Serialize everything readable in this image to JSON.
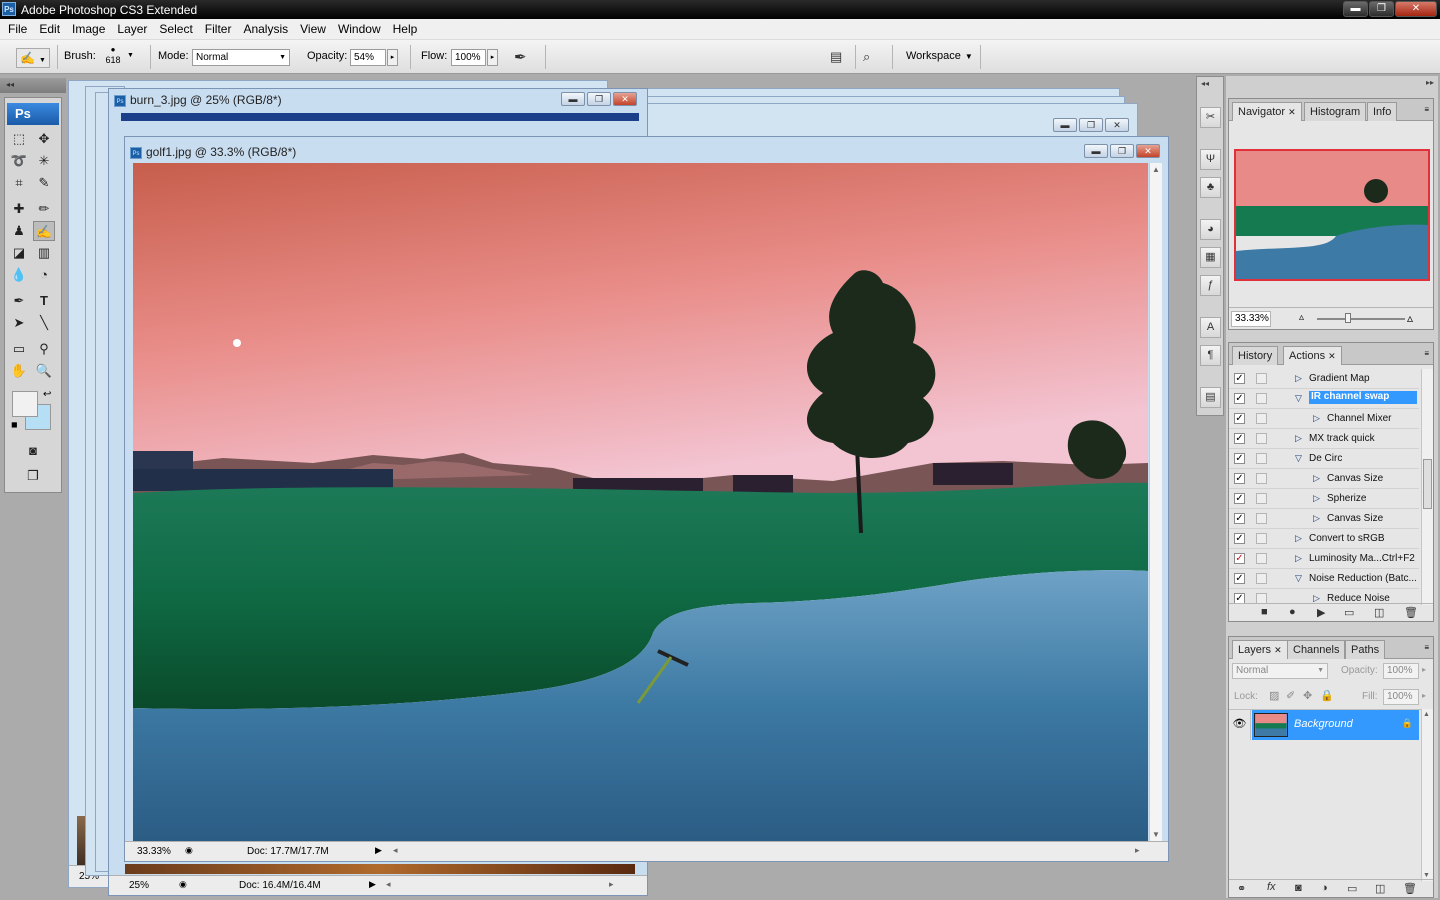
{
  "app": {
    "title": "Adobe Photoshop CS3 Extended",
    "badge": "Ps"
  },
  "window_buttons": {
    "minimize": "▬",
    "maximize": "❐",
    "close": "✕"
  },
  "menu": [
    "File",
    "Edit",
    "Image",
    "Layer",
    "Select",
    "Filter",
    "Analysis",
    "View",
    "Window",
    "Help"
  ],
  "options": {
    "brush_label": "Brush:",
    "brush_size": "618",
    "mode_label": "Mode:",
    "mode_value": "Normal",
    "opacity_label": "Opacity:",
    "opacity_value": "54%",
    "flow_label": "Flow:",
    "flow_value": "100%",
    "workspace_label": "Workspace"
  },
  "toolbox": {
    "logo": "Ps"
  },
  "documents": {
    "burn": {
      "title": "burn_3.jpg @ 25% (RGB/8*)",
      "zoom": "25%",
      "doc": "Doc: 16.4M/16.4M"
    },
    "golf": {
      "title": "golf1.jpg @ 33.3% (RGB/8*)",
      "zoom": "33.33%",
      "doc": "Doc: 17.7M/17.7M"
    },
    "back_zoom": "25%"
  },
  "navigator": {
    "tabs": [
      "Navigator",
      "Histogram",
      "Info"
    ],
    "zoom": "33.33%"
  },
  "actions_panel": {
    "tabs": [
      "History",
      "Actions"
    ],
    "items": [
      {
        "label": "Gradient Map",
        "indent": 1,
        "expanded": false,
        "checked": true,
        "red": false,
        "selected": false
      },
      {
        "label": "IR channel swap",
        "indent": 1,
        "expanded": true,
        "checked": true,
        "red": false,
        "selected": true
      },
      {
        "label": "Channel Mixer",
        "indent": 2,
        "expanded": false,
        "checked": true,
        "red": false,
        "selected": false
      },
      {
        "label": "MX track quick",
        "indent": 1,
        "expanded": false,
        "checked": true,
        "red": false,
        "selected": false
      },
      {
        "label": "De Circ",
        "indent": 1,
        "expanded": true,
        "checked": true,
        "red": false,
        "selected": false
      },
      {
        "label": "Canvas Size",
        "indent": 2,
        "expanded": false,
        "checked": true,
        "red": false,
        "selected": false
      },
      {
        "label": "Spherize",
        "indent": 2,
        "expanded": false,
        "checked": true,
        "red": false,
        "selected": false
      },
      {
        "label": "Canvas Size",
        "indent": 2,
        "expanded": false,
        "checked": true,
        "red": false,
        "selected": false
      },
      {
        "label": "Convert to sRGB",
        "indent": 1,
        "expanded": false,
        "checked": true,
        "red": false,
        "selected": false
      },
      {
        "label": "Luminosity Ma...Ctrl+F2",
        "indent": 1,
        "expanded": false,
        "checked": true,
        "red": true,
        "selected": false
      },
      {
        "label": "Noise Reduction (Batc...",
        "indent": 1,
        "expanded": true,
        "checked": true,
        "red": false,
        "selected": false
      },
      {
        "label": "Reduce Noise",
        "indent": 2,
        "expanded": false,
        "checked": true,
        "red": false,
        "selected": false
      }
    ]
  },
  "layers_panel": {
    "tabs": [
      "Layers",
      "Channels",
      "Paths"
    ],
    "blend_mode": "Normal",
    "opacity_label": "Opacity:",
    "opacity_value": "100%",
    "lock_label": "Lock:",
    "fill_label": "Fill:",
    "fill_value": "100%",
    "layer_name": "Background"
  },
  "colors": {
    "accent": "#3399ff",
    "selection": "#3399ff",
    "sky_top": "#c9604f",
    "sky_bottom": "#f0b9c6",
    "grass": "#14704a",
    "sand": "#3f7aa3"
  }
}
